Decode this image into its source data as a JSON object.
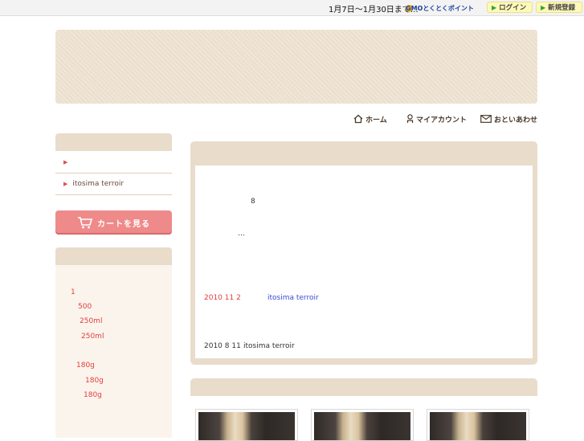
{
  "topbar": {
    "note": "1月7日～1月30日まで…",
    "gmo_label": "GMOとくとくポイント",
    "login_label": "ログイン",
    "register_label": "新規登録"
  },
  "gnav": {
    "home": "ホーム",
    "account": "マイアカウント",
    "contact": "おといあわせ"
  },
  "sidebar": {
    "categories": [
      "",
      "itosima terroir"
    ],
    "cart_label": "カートを見る",
    "ranking": [
      "1",
      "500",
      "250ml",
      "250ml",
      "180g",
      "180g",
      "180g"
    ]
  },
  "main": {
    "line1": "8",
    "line2": "…",
    "news1_date": "2010 11 2",
    "news1_link": "itosima terroir",
    "news2_date": "2010 8 11",
    "news2_text": "itosima terroir"
  },
  "colors": {
    "panel": "#e9dccb",
    "accent_red": "#e03c3c",
    "cart": "#ef8a8a"
  }
}
